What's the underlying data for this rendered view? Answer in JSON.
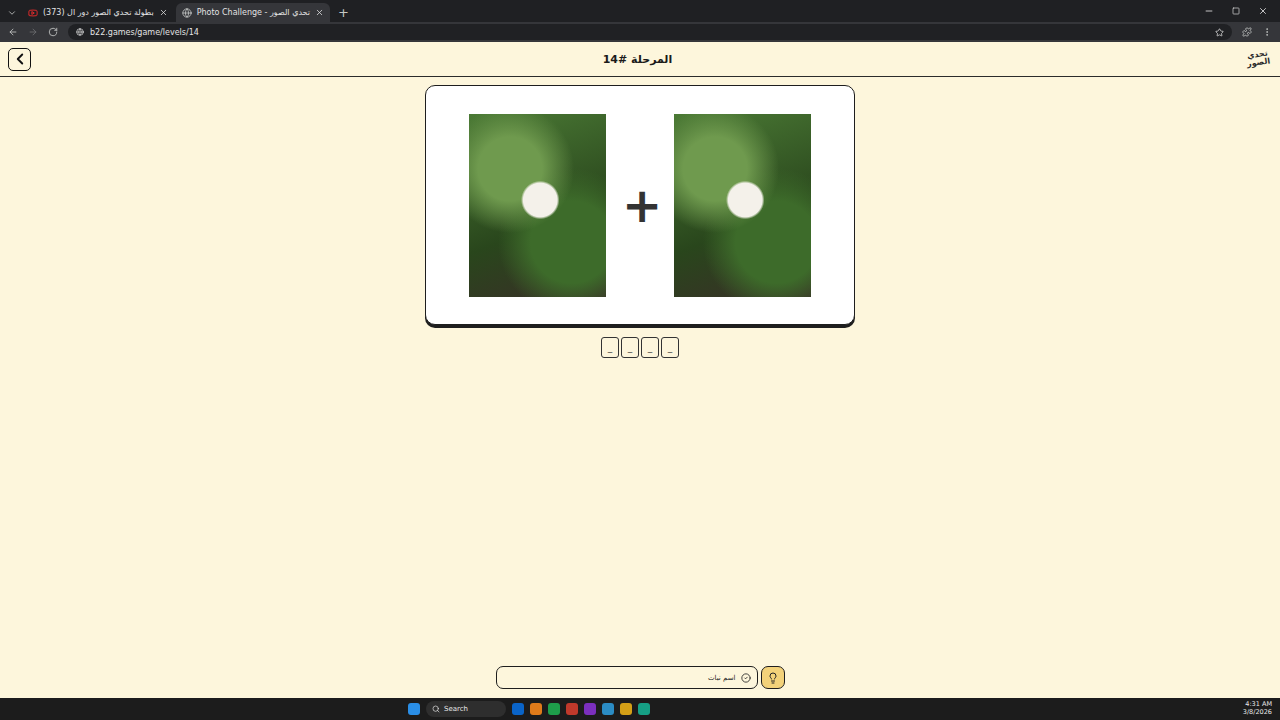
{
  "browser": {
    "tabs": [
      {
        "label": "(373) بطولة تحدي الصور دور ال",
        "selected": false
      },
      {
        "label": "Photo Challenge - تحدي الصور",
        "selected": true
      }
    ],
    "new_tab": "+",
    "address": "b22.games/game/levels/14"
  },
  "header": {
    "title": "المرحلة #14",
    "logo": "تحدي الصور"
  },
  "puzzle": {
    "operator": "+"
  },
  "answer": {
    "slots": [
      "_",
      "_",
      "_",
      "_"
    ]
  },
  "hint": {
    "text": "اسم نبات"
  },
  "taskbar": {
    "search": "Search",
    "time": "4:31 AM",
    "date": "3/8/2026"
  }
}
